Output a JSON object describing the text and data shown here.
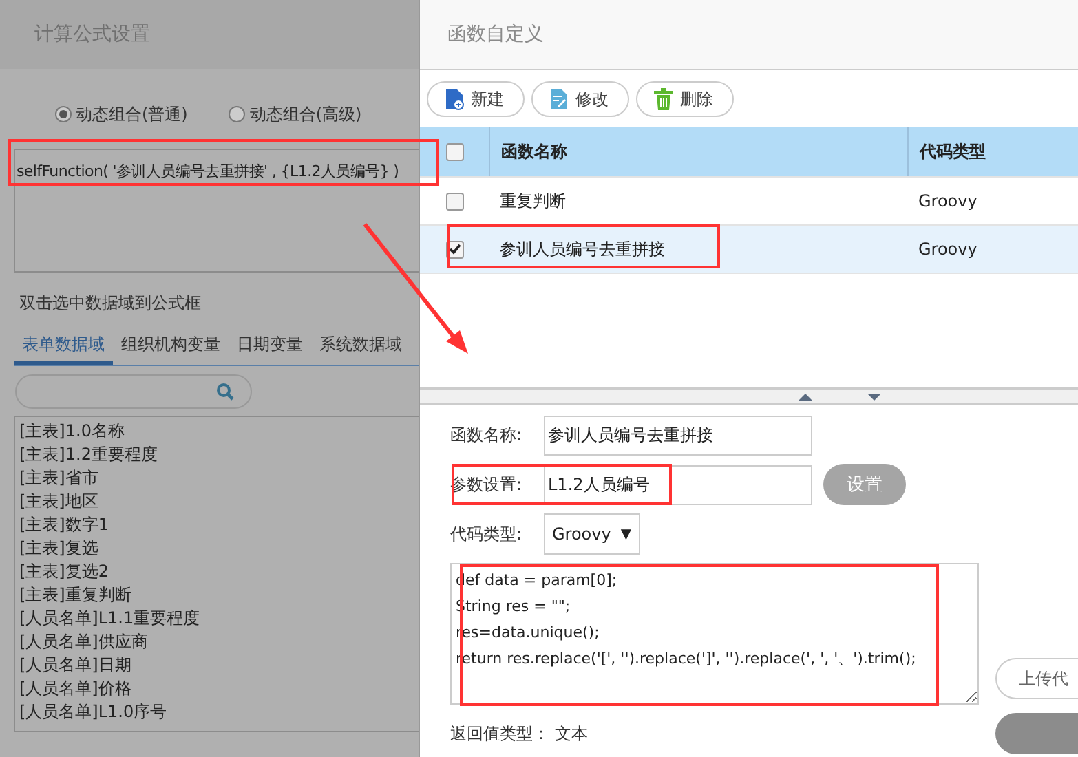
{
  "formula_dialog": {
    "title": "计算公式设置",
    "modes": [
      {
        "label": "动态组合(普通)",
        "selected": true
      },
      {
        "label": "动态组合(高级)",
        "selected": false
      }
    ],
    "formula": "selfFunction( '参训人员编号去重拼接' , {L1.2人员编号} )",
    "hint": "双击选中数据域到公式框",
    "tabs": [
      {
        "label": "表单数据域",
        "selected": true
      },
      {
        "label": "组织机构变量",
        "selected": false
      },
      {
        "label": "日期变量",
        "selected": false
      },
      {
        "label": "系统数据域",
        "selected": false
      }
    ],
    "fields": [
      "[主表]1.0名称",
      "[主表]1.2重要程度",
      "[主表]省市",
      "[主表]地区",
      "[主表]数字1",
      "[主表]复选",
      "[主表]复选2",
      "[主表]重复判断",
      "[人员名单]L1.1重要程度",
      "[人员名单]供应商",
      "[人员名单]日期",
      "[人员名单]价格",
      "[人员名单]L1.0序号"
    ]
  },
  "function_dialog": {
    "title": "函数自定义",
    "toolbar": [
      {
        "kind": "new",
        "label": "新建"
      },
      {
        "kind": "edit",
        "label": "修改"
      },
      {
        "kind": "delete",
        "label": "删除"
      }
    ],
    "table": {
      "header_checked": false,
      "columns": [
        "函数名称",
        "代码类型"
      ],
      "rows": [
        {
          "checked": false,
          "selected": false,
          "name": "重复判断",
          "type": "Groovy"
        },
        {
          "checked": true,
          "selected": true,
          "name": "参训人员编号去重拼接",
          "type": "Groovy"
        }
      ]
    },
    "form": {
      "name_label": "函数名称:",
      "name_value": "参训人员编号去重拼接",
      "param_label": "参数设置:",
      "param_value": "L1.2人员编号",
      "param_button": "设置",
      "type_label": "代码类型:",
      "type_value": "Groovy",
      "type_caret": "▼",
      "code": [
        "def data = param[0];",
        "String res = \"\";",
        "res=data.unique();",
        "return res.replace('[', '').replace(']', '').replace(', ', '、').trim();"
      ],
      "upload_button": "上传代",
      "return_label": "返回值类型：",
      "return_value": "文本"
    }
  }
}
